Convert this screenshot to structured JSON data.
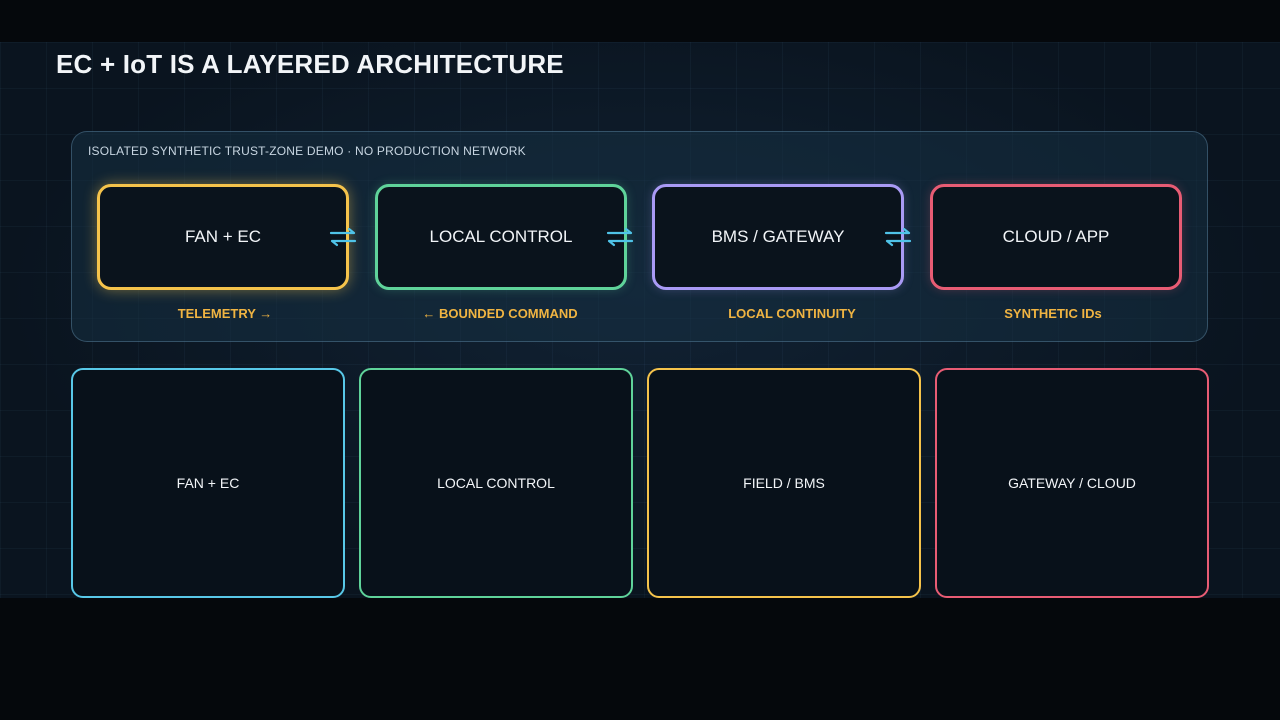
{
  "title": "EC + IoT IS A LAYERED ARCHITECTURE",
  "trust_zone": {
    "label": "ISOLATED SYNTHETIC TRUST-ZONE DEMO · NO PRODUCTION NETWORK",
    "nodes": [
      {
        "label": "FAN + EC",
        "color": "#f5c34b"
      },
      {
        "label": "LOCAL CONTROL",
        "color": "#5fd39a"
      },
      {
        "label": "BMS / GATEWAY",
        "color": "#a99af5"
      },
      {
        "label": "CLOUD / APP",
        "color": "#e85c74"
      }
    ],
    "captions": [
      "TELEMETRY →",
      "← BOUNDED COMMAND",
      "LOCAL CONTINUITY",
      "SYNTHETIC IDs"
    ],
    "connector_icon": "bidirectional-arrows-icon",
    "connector_color": "#4fc3e8"
  },
  "layers": [
    {
      "label": "FAN + EC",
      "color": "#58c8e8"
    },
    {
      "label": "LOCAL CONTROL",
      "color": "#5fd39a"
    },
    {
      "label": "FIELD / BMS",
      "color": "#f5c34b"
    },
    {
      "label": "GATEWAY / CLOUD",
      "color": "#e85c74"
    }
  ]
}
